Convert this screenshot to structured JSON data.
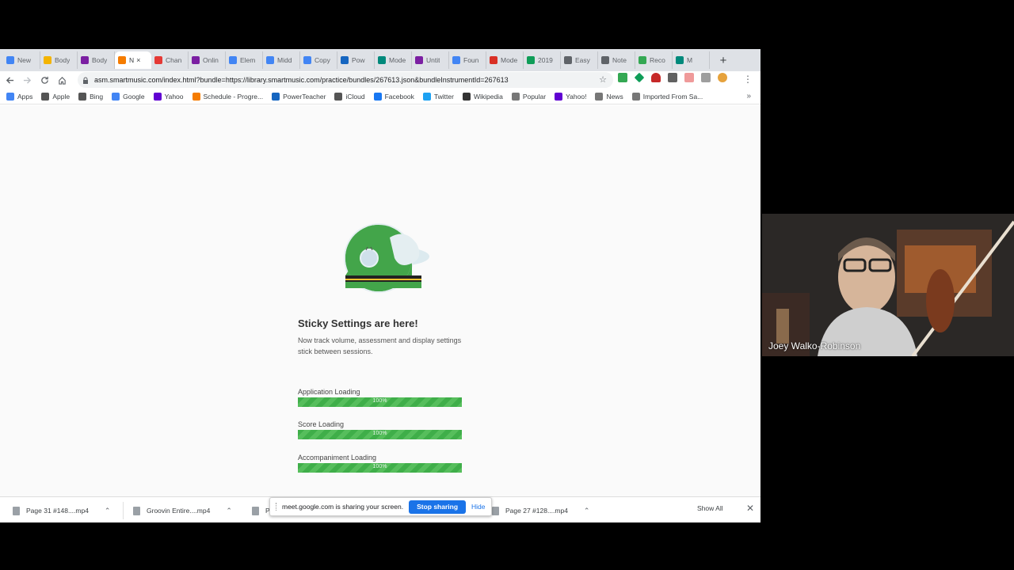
{
  "tabs": [
    {
      "label": "New",
      "color": "#4285f4"
    },
    {
      "label": "Body",
      "color": "#f4b400"
    },
    {
      "label": "Body",
      "color": "#7b1fa2"
    },
    {
      "label": "N",
      "color": "#f57c00",
      "active": true
    },
    {
      "label": "Chan",
      "color": "#e53935"
    },
    {
      "label": "Onlin",
      "color": "#7b1fa2"
    },
    {
      "label": "Elem",
      "color": "#4285f4"
    },
    {
      "label": "Midd",
      "color": "#4285f4"
    },
    {
      "label": "Copy",
      "color": "#4285f4"
    },
    {
      "label": "Pow",
      "color": "#1565c0"
    },
    {
      "label": "Mode",
      "color": "#00897b"
    },
    {
      "label": "Untit",
      "color": "#7b1fa2"
    },
    {
      "label": "Foun",
      "color": "#4285f4"
    },
    {
      "label": "Mode",
      "color": "#d93025"
    },
    {
      "label": "2019",
      "color": "#0f9d58"
    },
    {
      "label": "Easy",
      "color": "#5f6368"
    },
    {
      "label": "Note",
      "color": "#5f6368"
    },
    {
      "label": "Reco",
      "color": "#34a853"
    },
    {
      "label": "M",
      "color": "#00897b"
    }
  ],
  "tab_close": "×",
  "new_tab": "+",
  "address": {
    "url": "asm.smartmusic.com/index.html?bundle=https://library.smartmusic.com/practice/bundles/267613.json&bundleInstrumentId=267613"
  },
  "bookmarks": [
    {
      "label": "Apps",
      "color": "#4285f4"
    },
    {
      "label": "Apple",
      "color": "#555555"
    },
    {
      "label": "Bing",
      "color": "#555555"
    },
    {
      "label": "Google",
      "color": "#4285f4"
    },
    {
      "label": "Yahoo",
      "color": "#6001d2"
    },
    {
      "label": "Schedule - Progre...",
      "color": "#f57c00"
    },
    {
      "label": "PowerTeacher",
      "color": "#1565c0"
    },
    {
      "label": "iCloud",
      "color": "#555555"
    },
    {
      "label": "Facebook",
      "color": "#1877f2"
    },
    {
      "label": "Twitter",
      "color": "#1da1f2"
    },
    {
      "label": "Wikipedia",
      "color": "#333333"
    },
    {
      "label": "Popular",
      "color": "#777777"
    },
    {
      "label": "Yahoo!",
      "color": "#6001d2"
    },
    {
      "label": "News",
      "color": "#777777"
    },
    {
      "label": "Imported From Sa...",
      "color": "#777777"
    }
  ],
  "bookmarks_more": "»",
  "page": {
    "headline": "Sticky Settings are here!",
    "subtext": "Now track volume, assessment and display settings stick between sessions.",
    "loaders": [
      {
        "label": "Application Loading",
        "percent_text": "100%",
        "progress": 1.0
      },
      {
        "label": "Score Loading",
        "percent_text": "100%",
        "progress": 1.0
      },
      {
        "label": "Accompaniment Loading",
        "percent_text": "100%",
        "progress": 1.0
      }
    ]
  },
  "downloads": [
    {
      "name": "Page 31 #148....mp4"
    },
    {
      "name": "Groovin Entire....mp4"
    },
    {
      "name": "P"
    },
    {
      "name": "Page 27 #128....mp4"
    }
  ],
  "show_all": "Show All",
  "share_bar": {
    "message": "meet.google.com is sharing your screen.",
    "stop": "Stop sharing",
    "hide": "Hide"
  },
  "video": {
    "participant": "Joey Walko-Robinson"
  }
}
